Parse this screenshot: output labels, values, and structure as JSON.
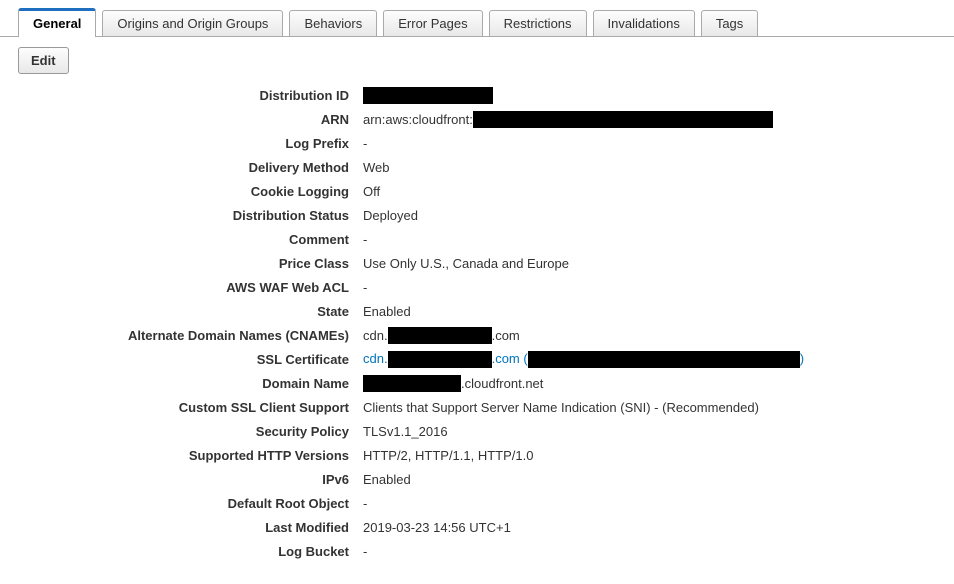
{
  "tabs": {
    "general": "General",
    "origins": "Origins and Origin Groups",
    "behaviors": "Behaviors",
    "errorPages": "Error Pages",
    "restrictions": "Restrictions",
    "invalidations": "Invalidations",
    "tags": "Tags"
  },
  "toolbar": {
    "edit": "Edit"
  },
  "labels": {
    "distributionId": "Distribution ID",
    "arn": "ARN",
    "logPrefix": "Log Prefix",
    "deliveryMethod": "Delivery Method",
    "cookieLogging": "Cookie Logging",
    "distributionStatus": "Distribution Status",
    "comment": "Comment",
    "priceClass": "Price Class",
    "awsWafWebAcl": "AWS WAF Web ACL",
    "state": "State",
    "cnames": "Alternate Domain Names (CNAMEs)",
    "sslCert": "SSL Certificate",
    "domainName": "Domain Name",
    "customSsl": "Custom SSL Client Support",
    "securityPolicy": "Security Policy",
    "httpVersions": "Supported HTTP Versions",
    "ipv6": "IPv6",
    "defaultRoot": "Default Root Object",
    "lastModified": "Last Modified",
    "logBucket": "Log Bucket"
  },
  "values": {
    "arnPrefix": "arn:aws:cloudfront:",
    "logPrefix": "-",
    "deliveryMethod": "Web",
    "cookieLogging": "Off",
    "distributionStatus": "Deployed",
    "comment": "-",
    "priceClass": "Use Only U.S., Canada and Europe",
    "awsWafWebAcl": "-",
    "state": "Enabled",
    "cnamesPrefix": "cdn.",
    "cnamesSuffix": ".com",
    "sslPrefix": "cdn.",
    "sslMid": ".com (",
    "sslSuffix": ")",
    "domainSuffix": ".cloudfront.net",
    "customSsl": "Clients that Support Server Name Indication (SNI) - (Recommended)",
    "securityPolicy": "TLSv1.1_2016",
    "httpVersions": "HTTP/2, HTTP/1.1, HTTP/1.0",
    "ipv6": "Enabled",
    "defaultRoot": "-",
    "lastModified": "2019-03-23 14:56 UTC+1",
    "logBucket": "-"
  }
}
